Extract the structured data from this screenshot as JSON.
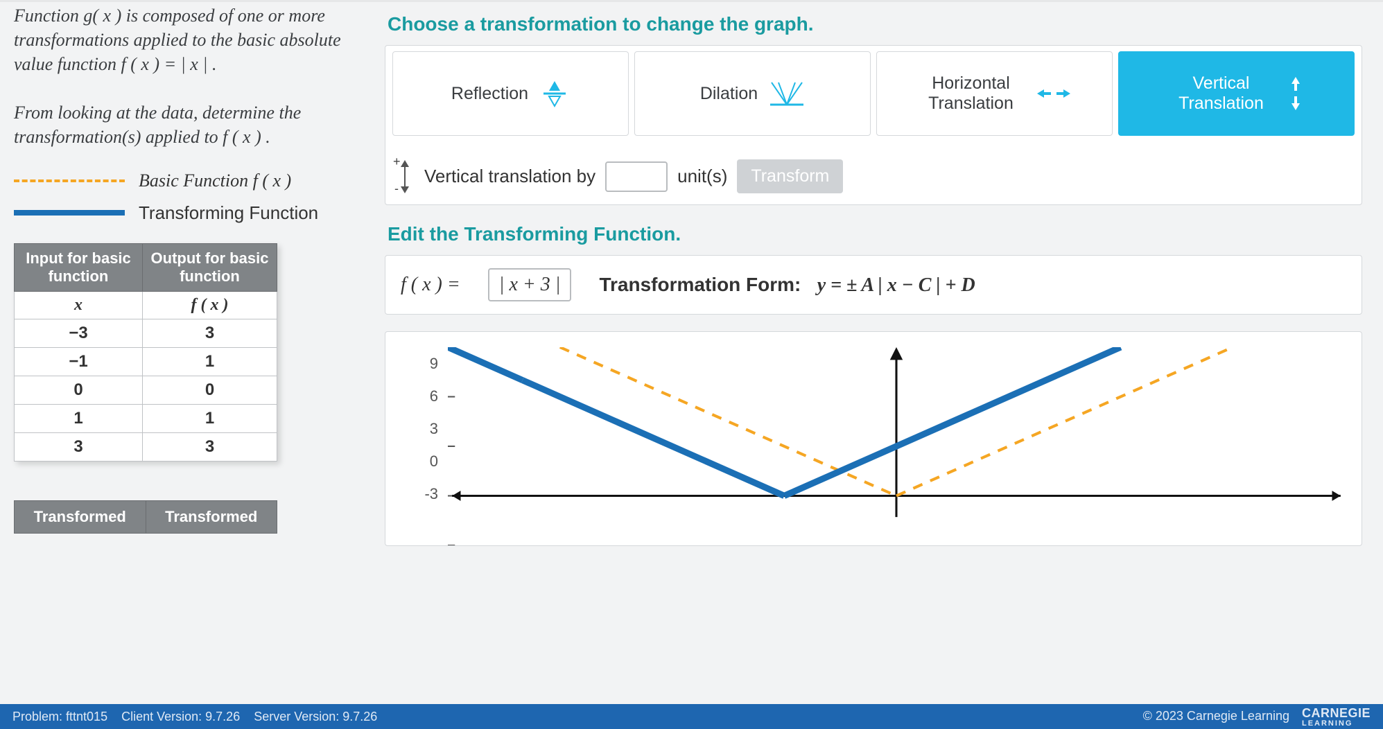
{
  "problem": {
    "lines": [
      "Function  g( x )  is composed of one or more transformations applied to the basic absolute value function  f ( x ) = | x | .",
      "From looking at the data, determine the transformation(s) applied to  f ( x ) ."
    ]
  },
  "legend": {
    "basic": "Basic Function  f ( x )",
    "transforming": "Transforming Function"
  },
  "table1": {
    "headers": [
      "Input for basic function",
      "Output for basic function"
    ],
    "subheaders": [
      "x",
      "f ( x )"
    ],
    "rows": [
      [
        "−3",
        "3"
      ],
      [
        "−1",
        "1"
      ],
      [
        "0",
        "0"
      ],
      [
        "1",
        "1"
      ],
      [
        "3",
        "3"
      ]
    ]
  },
  "table2": {
    "headers": [
      "Transformed",
      "Transformed"
    ]
  },
  "right": {
    "choose_title": "Choose a transformation to change the graph.",
    "tabs": {
      "reflection": "Reflection",
      "dilation": "Dilation",
      "horiz": "Horizontal Translation",
      "vert": "Vertical Translation"
    },
    "controls": {
      "label": "Vertical translation by",
      "unit": "unit(s)",
      "button": "Transform",
      "value": ""
    },
    "edit_title": "Edit the Transforming Function.",
    "fx_label": "f ( x )  =",
    "fx_value": "| x + 3 |",
    "tf_label": "Transformation Form:",
    "tf_form": "y = ± A | x − C |  +  D"
  },
  "graph": {
    "y_ticks": [
      "9",
      "6",
      "3",
      "0",
      "-3"
    ]
  },
  "chart_data": {
    "type": "line",
    "title": "",
    "xlabel": "",
    "ylabel": "",
    "xlim": [
      -12,
      12
    ],
    "ylim": [
      -3,
      9
    ],
    "y_ticks": [
      9,
      6,
      3,
      0,
      -3
    ],
    "series": [
      {
        "name": "Basic Function f(x) = |x|",
        "style": "dashed-orange",
        "formula": "|x|",
        "points": [
          {
            "x": -9,
            "y": 9
          },
          {
            "x": 0,
            "y": 0
          },
          {
            "x": 9,
            "y": 9
          }
        ]
      },
      {
        "name": "Transforming Function f(x) = |x+3|",
        "style": "solid-blue",
        "formula": "|x+3|",
        "points": [
          {
            "x": -12,
            "y": 9
          },
          {
            "x": -10,
            "y": 7
          },
          {
            "x": -3,
            "y": 0
          },
          {
            "x": 6,
            "y": 9
          }
        ]
      }
    ]
  },
  "footer": {
    "problem_id": "Problem: fttnt015",
    "client": "Client Version: 9.7.26",
    "server": "Server Version: 9.7.26",
    "copyright": "© 2023 Carnegie Learning",
    "brand_top": "CARNEGIE",
    "brand_bot": "LEARNING"
  }
}
